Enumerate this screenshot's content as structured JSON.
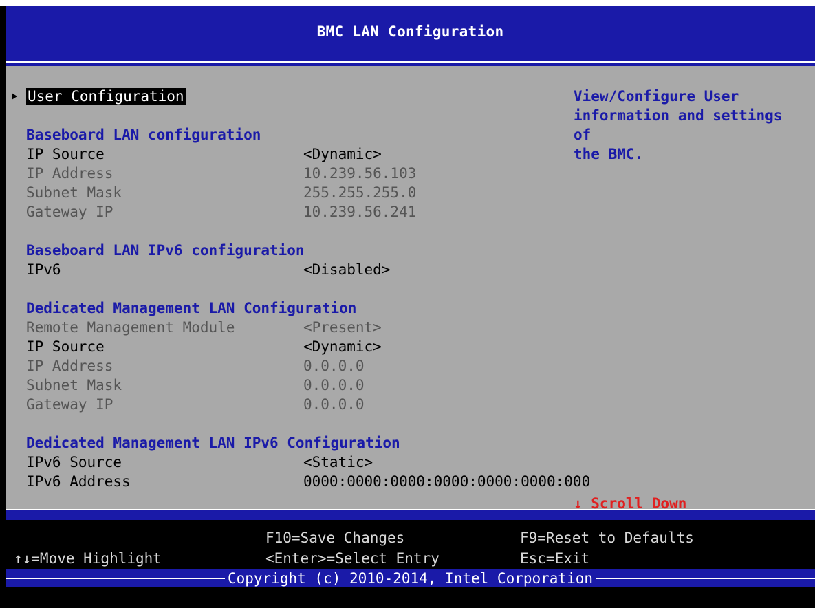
{
  "header": {
    "title": "BMC LAN Configuration"
  },
  "menu": {
    "selected_item": "User Configuration"
  },
  "sections": {
    "baseboard_lan": {
      "heading": "Baseboard LAN configuration",
      "ip_source_label": "IP Source",
      "ip_source_value": "<Dynamic>",
      "ip_address_label": "IP Address",
      "ip_address_value": "10.239.56.103",
      "subnet_mask_label": "Subnet Mask",
      "subnet_mask_value": "255.255.255.0",
      "gateway_label": "Gateway IP",
      "gateway_value": "10.239.56.241"
    },
    "baseboard_ipv6": {
      "heading": "Baseboard LAN IPv6 configuration",
      "ipv6_label": "IPv6",
      "ipv6_value": "<Disabled>"
    },
    "dedicated_lan": {
      "heading": "Dedicated Management LAN Configuration",
      "rmm_label": "Remote Management Module",
      "rmm_value": "<Present>",
      "ip_source_label": "IP Source",
      "ip_source_value": "<Dynamic>",
      "ip_address_label": "IP Address",
      "ip_address_value": "0.0.0.0",
      "subnet_mask_label": "Subnet Mask",
      "subnet_mask_value": "0.0.0.0",
      "gateway_label": "Gateway IP",
      "gateway_value": "0.0.0.0"
    },
    "dedicated_ipv6": {
      "heading": "Dedicated Management LAN IPv6 Configuration",
      "ipv6_source_label": "IPv6 Source",
      "ipv6_source_value": "<Static>",
      "ipv6_address_label": "IPv6 Address",
      "ipv6_address_value": "0000:0000:0000:0000:0000:0000:000"
    }
  },
  "help": {
    "line1": "View/Configure User",
    "line2": "information and settings of",
    "line3": "the BMC."
  },
  "scroll_hint": "↓ Scroll Down",
  "footer": {
    "move": "↑↓=Move Highlight",
    "save": "F10=Save Changes",
    "select": "<Enter>=Select Entry",
    "reset": "F9=Reset to Defaults",
    "exit": "Esc=Exit",
    "copyright": "Copyright (c) 2010-2014, Intel Corporation"
  },
  "colors": {
    "header_bg": "#1a1aa8",
    "main_bg": "#a9a9a9",
    "heading_blue": "#1a1aa8",
    "scroll_red": "#e02020"
  }
}
